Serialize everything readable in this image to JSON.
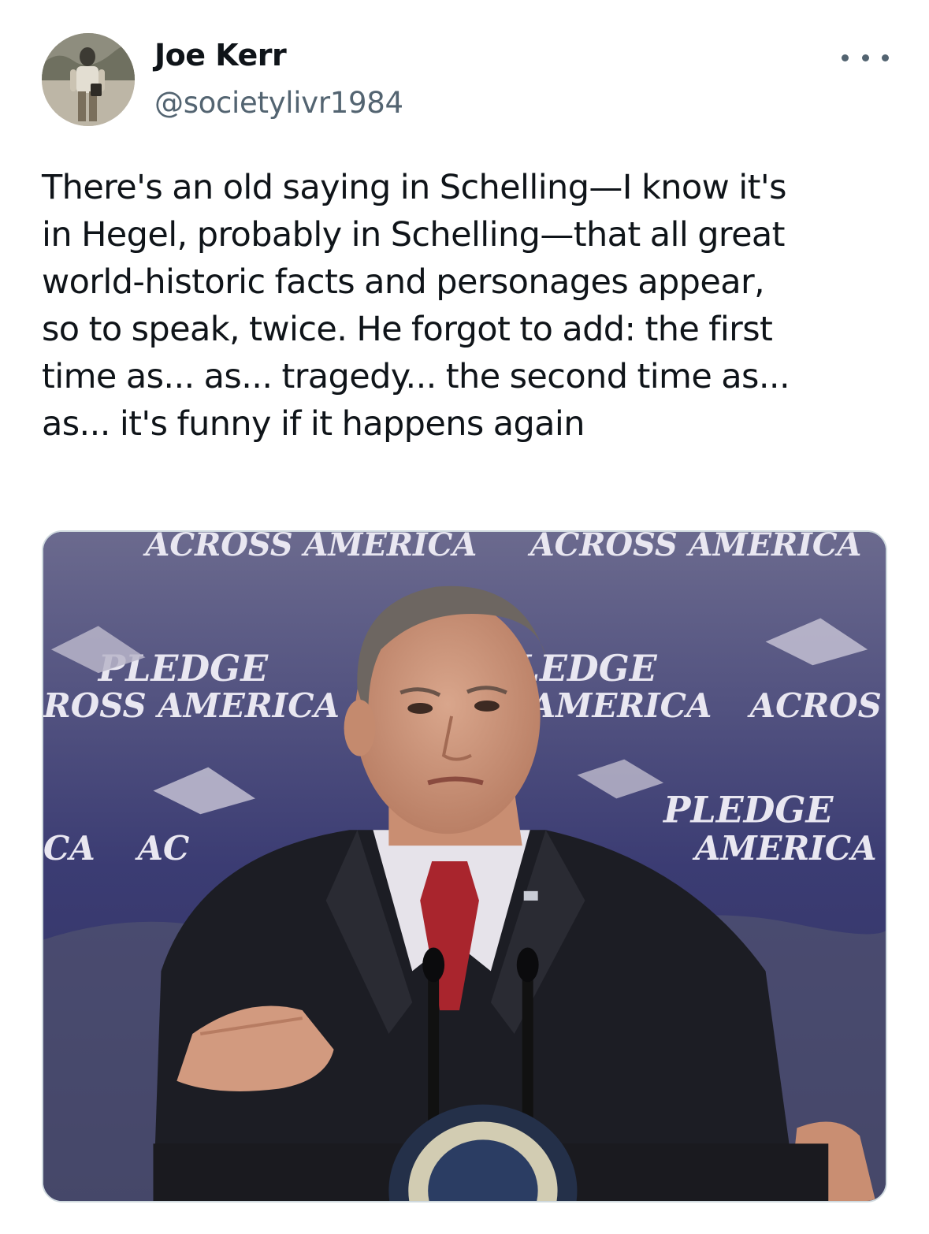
{
  "tweet": {
    "author": {
      "display_name": "Joe Kerr",
      "handle": "@societylivr1984",
      "avatar_icon": "user-avatar-photo"
    },
    "more_icon": "more-horizontal-icon",
    "text_lines": [
      "There's an old saying in Schelling—I know it's",
      "in Hegel, probably in Schelling—that all great",
      "world-historic facts and personages appear,",
      "so to speak, twice. He forgot to add: the first",
      "time as... as... tragedy... the second time as...",
      "as... it's funny if it happens again"
    ],
    "media": {
      "banner_texts": [
        "ACROSS AMERICA",
        "ACROSS AMERICA",
        "PLEDGE",
        "ROSS AMERICA",
        "LEDGE",
        "AMERICA",
        "ACROS",
        "PLEDGE",
        "AMERICA",
        "CA",
        "AC"
      ]
    }
  },
  "colors": {
    "text_primary": "#0f1419",
    "text_secondary": "#536471",
    "border": "#cfd9de",
    "backdrop": "#3a3a6a"
  }
}
